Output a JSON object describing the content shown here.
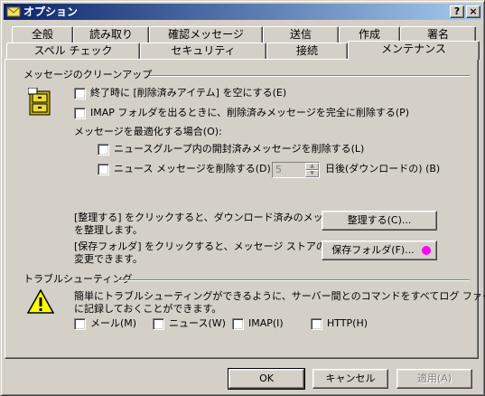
{
  "window": {
    "title": "オプション",
    "help_btn": "?",
    "close_btn": "×"
  },
  "tabs_back": [
    "全般",
    "読み取り",
    "確認メッセージ",
    "送信",
    "作成",
    "署名"
  ],
  "tabs_front": [
    "スペル チェック",
    "セキュリティ",
    "接続",
    "メンテナンス"
  ],
  "cleanup": {
    "heading": "メッセージのクリーンアップ",
    "empty_deleted": "終了時に [削除済みアイテム] を空にする(E)",
    "purge_imap": "IMAP フォルダを出るときに、削除済みメッセージを完全に削除する(P)",
    "compact_label": "メッセージを最適化する場合(O):",
    "delete_read_news": "ニュースグループ内の開封済みメッセージを削除する(L)",
    "delete_news": "ニュース メッセージを削除する(D)",
    "days_value": "5",
    "days_suffix": "日後(ダウンロードの) (B)",
    "cleanup_desc_1": "[整理する] をクリックすると、ダウンロード済みのメッセージ",
    "cleanup_desc_2": "を整理します。",
    "cleanup_button": "整理する(C)...",
    "store_desc_1": "[保存フォルダ] をクリックすると、メッセージ ストアの場所を",
    "store_desc_2": "変更できます。",
    "store_button": "保存フォルダ(F)..."
  },
  "troubleshoot": {
    "heading": "トラブルシューティング",
    "desc_1": "簡単にトラブルシューティングができるように、サーバー間とのコマンドをすべてログ ファイル",
    "desc_2": "に記録しておくことができます。",
    "mail": "メール(M)",
    "news": "ニュース(W)",
    "imap": "IMAP(I)",
    "http": "HTTP(H)"
  },
  "footer": {
    "ok": "OK",
    "cancel": "キャンセル",
    "apply": "適用(A)"
  },
  "colors": {
    "title_start": "#0a246a",
    "title_end": "#a6caf0",
    "face": "#d4d0c8",
    "marker": "#ff00ff"
  }
}
